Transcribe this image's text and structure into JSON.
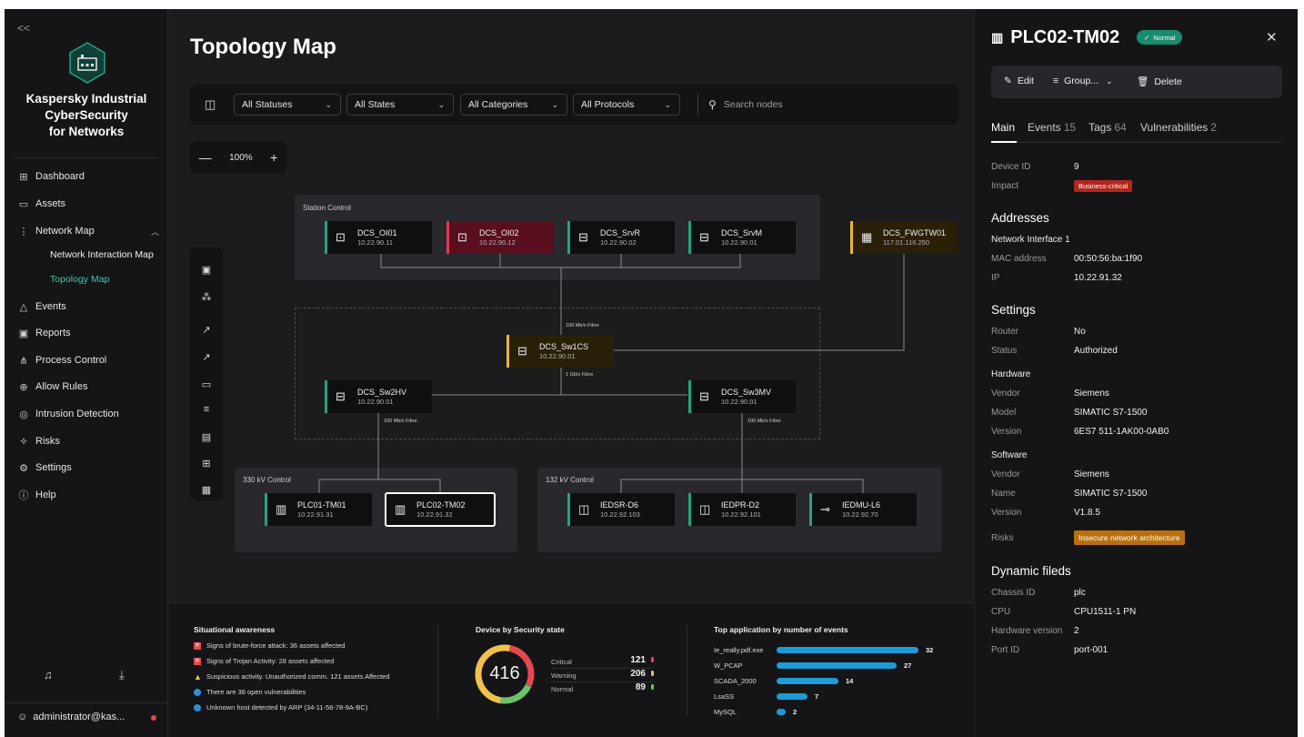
{
  "sidebar": {
    "collapse_glyph": "<<",
    "brand": [
      "Kaspersky Industrial",
      "CyberSecurity",
      "for Networks"
    ],
    "items": [
      {
        "label": "Dashboard",
        "icon": "dashboard-icon"
      },
      {
        "label": "Assets",
        "icon": "assets-icon"
      },
      {
        "label": "Network Map",
        "icon": "network-map-icon"
      },
      {
        "label": "Network Interaction Map"
      },
      {
        "label": "Topology Map"
      },
      {
        "label": "Events",
        "icon": "warning-icon"
      },
      {
        "label": "Reports",
        "icon": "reports-icon"
      },
      {
        "label": "Process Control",
        "icon": "process-control-icon"
      },
      {
        "label": "Allow Rules",
        "icon": "globe-icon"
      },
      {
        "label": "Intrusion Detection",
        "icon": "intrusion-icon"
      },
      {
        "label": "Risks",
        "icon": "risks-icon"
      },
      {
        "label": "Settings",
        "icon": "gear-icon"
      },
      {
        "label": "Help",
        "icon": "help-icon"
      }
    ],
    "user": "administrator@kas..."
  },
  "main": {
    "title": "Topology Map",
    "filters": [
      "All Statuses",
      "All States",
      "All Categories",
      "All Protocols"
    ],
    "search_placeholder": "Search nodes",
    "zoom": "100%",
    "groups": {
      "station": "Station Control",
      "kv330": "330 kV Control",
      "kv132": "132 kV Control"
    },
    "nodes": [
      {
        "name": "DCS_OI01",
        "ip": "10.22.90.11"
      },
      {
        "name": "DCS_OI02",
        "ip": "10.22.90.12"
      },
      {
        "name": "DCS_SrvR",
        "ip": "10.22.90.02"
      },
      {
        "name": "DCS_SrvM",
        "ip": "10.22.90.01"
      },
      {
        "name": "DCS_FWGTW01",
        "ip": "117.01.116.250"
      },
      {
        "name": "DCS_Sw1CS",
        "ip": "10.22.90.01"
      },
      {
        "name": "DCS_Sw2HV",
        "ip": "10.22.90.01"
      },
      {
        "name": "DCS_Sw3MV",
        "ip": "10.22.90.01"
      },
      {
        "name": "PLC01-TM01",
        "ip": "10.22.91.31"
      },
      {
        "name": "PLC02-TM02",
        "ip": "10.22.91.32"
      },
      {
        "name": "IEDSR-D6",
        "ip": "10.22.92.103"
      },
      {
        "name": "IEDPR-D2",
        "ip": "10.22.92.101"
      },
      {
        "name": "IEDMU-L6",
        "ip": "10.22.92.70"
      }
    ],
    "link_labels": [
      "100 Mb/s Fibre",
      "1 Gb/s Fibre",
      "100 Mb/s Fibre",
      "100 Mb/s Fibre"
    ]
  },
  "bottom": {
    "situational": {
      "title": "Situational awareness",
      "items": [
        "Signs of brute-force attack: 36 assets affected",
        "Signs of Trojan Activity: 28 assets affected",
        "Suspicious activity. Unauthorized comm. 121 assets Affected",
        "There are 38 open vulnerabilities",
        "Unknown host detected by ARP (34-11-56-78-9A-BC)"
      ]
    },
    "security": {
      "title": "Device by Security state",
      "total": "416",
      "rows": [
        {
          "label": "Critical",
          "value": 121,
          "color": "#e5484d"
        },
        {
          "label": "Warning",
          "value": 206,
          "color": "#f0c24b"
        },
        {
          "label": "Normal",
          "value": 89,
          "color": "#6cc36a"
        }
      ]
    },
    "apps": {
      "title": "Top application by number of events",
      "rows": [
        {
          "label": "Ie_really.pdf.exe",
          "value": 32
        },
        {
          "label": "W_PCAP",
          "value": 27
        },
        {
          "label": "SCADA_2000",
          "value": 14
        },
        {
          "label": "LsaSS",
          "value": 7
        },
        {
          "label": "MySQL",
          "value": 2
        }
      ]
    }
  },
  "panel": {
    "title": "PLC02-TM02",
    "status": "Normal",
    "actions": {
      "edit": "Edit",
      "group": "Group...",
      "delete": "Delete"
    },
    "tabs": [
      {
        "label": "Main",
        "count": ""
      },
      {
        "label": "Events",
        "count": "15"
      },
      {
        "label": "Tags",
        "count": "64"
      },
      {
        "label": "Vulnerabilities",
        "count": "2"
      }
    ],
    "device_id_label": "Device ID",
    "device_id": "9",
    "impact_label": "Impact",
    "impact": "Business-critical",
    "addresses_title": "Addresses",
    "interface": "Network Interface 1",
    "mac_label": "MAC address",
    "mac": "00:50:56:ba:1f90",
    "ip_label": "IP",
    "ip": "10.22.91.32",
    "settings_title": "Settings",
    "router_label": "Router",
    "router": "No",
    "status_label": "Status",
    "status_value": "Authorized",
    "hardware_title": "Hardware",
    "hw_vendor_label": "Vendor",
    "hw_vendor": "Siemens",
    "hw_model_label": "Model",
    "hw_model": "SIMATIC S7-1500",
    "hw_version_label": "Version",
    "hw_version": "6ES7 511-1AK00-0AB0",
    "software_title": "Software",
    "sw_vendor_label": "Vendor",
    "sw_vendor": "Siemens",
    "sw_name_label": "Name",
    "sw_name": "SIMATIC S7-1500",
    "sw_version_label": "Version",
    "sw_version": "V1.8.5",
    "risks_label": "Risks",
    "risks": "Insecure network architecture",
    "dynamic_title": "Dynamic fileds",
    "chassis_label": "Chassis ID",
    "chassis": "plc",
    "cpu_label": "CPU",
    "cpu": "CPU1511-1 PN",
    "hwver_label": "Hardware version",
    "hwver": "2",
    "port_label": "Port ID",
    "port": "port-001"
  }
}
